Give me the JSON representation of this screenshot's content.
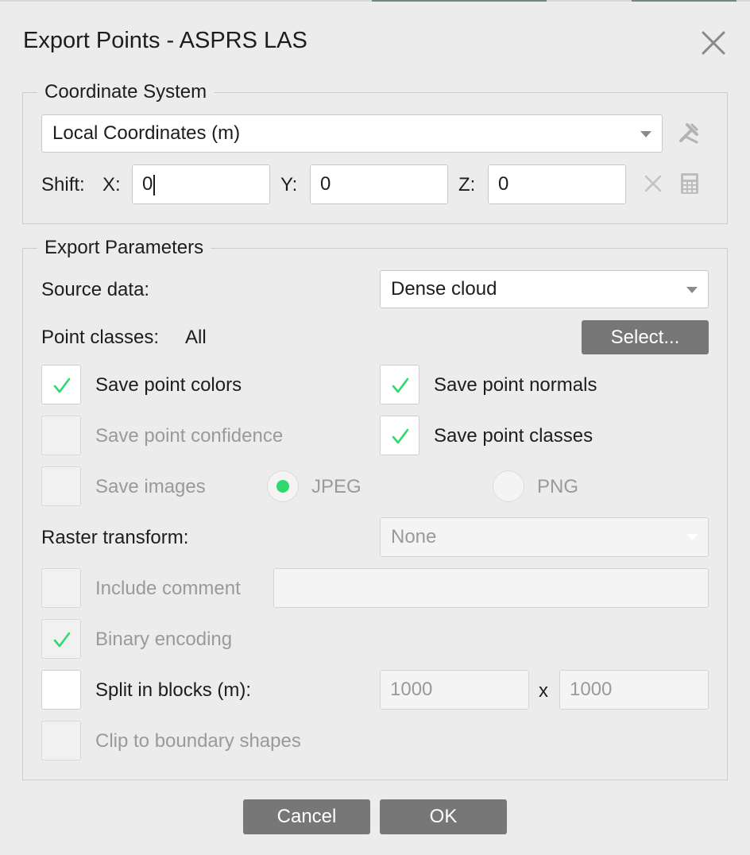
{
  "dialog": {
    "title": "Export Points - ASPRS LAS"
  },
  "coordinate_system": {
    "legend": "Coordinate System",
    "crs_value": "Local Coordinates (m)",
    "shift_label": "Shift:",
    "x_label": "X:",
    "x_value": "0",
    "y_label": "Y:",
    "y_value": "0",
    "z_label": "Z:",
    "z_value": "0"
  },
  "export_parameters": {
    "legend": "Export Parameters",
    "source_label": "Source data:",
    "source_value": "Dense cloud",
    "point_classes_label": "Point classes:",
    "point_classes_value": "All",
    "select_button": "Select...",
    "save_point_colors": {
      "label": "Save point colors",
      "checked": true
    },
    "save_point_normals": {
      "label": "Save point normals",
      "checked": true
    },
    "save_point_confidence": {
      "label": "Save point confidence",
      "checked": false,
      "enabled": false
    },
    "save_point_classes": {
      "label": "Save point classes",
      "checked": true
    },
    "save_images": {
      "label": "Save images",
      "checked": false,
      "enabled": false
    },
    "format_jpeg": {
      "label": "JPEG",
      "selected": true
    },
    "format_png": {
      "label": "PNG",
      "selected": false
    },
    "raster_transform_label": "Raster transform:",
    "raster_transform_value": "None",
    "include_comment": {
      "label": "Include comment",
      "checked": false,
      "enabled": false,
      "value": ""
    },
    "binary_encoding": {
      "label": "Binary encoding",
      "checked": true,
      "enabled": false
    },
    "split_in_blocks": {
      "label": "Split in blocks (m):",
      "checked": false
    },
    "block_width": "1000",
    "block_separator": "x",
    "block_height": "1000",
    "clip_to_boundary": {
      "label": "Clip to boundary shapes",
      "checked": false,
      "enabled": false
    }
  },
  "buttons": {
    "cancel": "Cancel",
    "ok": "OK"
  },
  "colors": {
    "check_green": "#2ed96d",
    "button_gray": "#777777",
    "dialog_bg": "#ececec"
  }
}
